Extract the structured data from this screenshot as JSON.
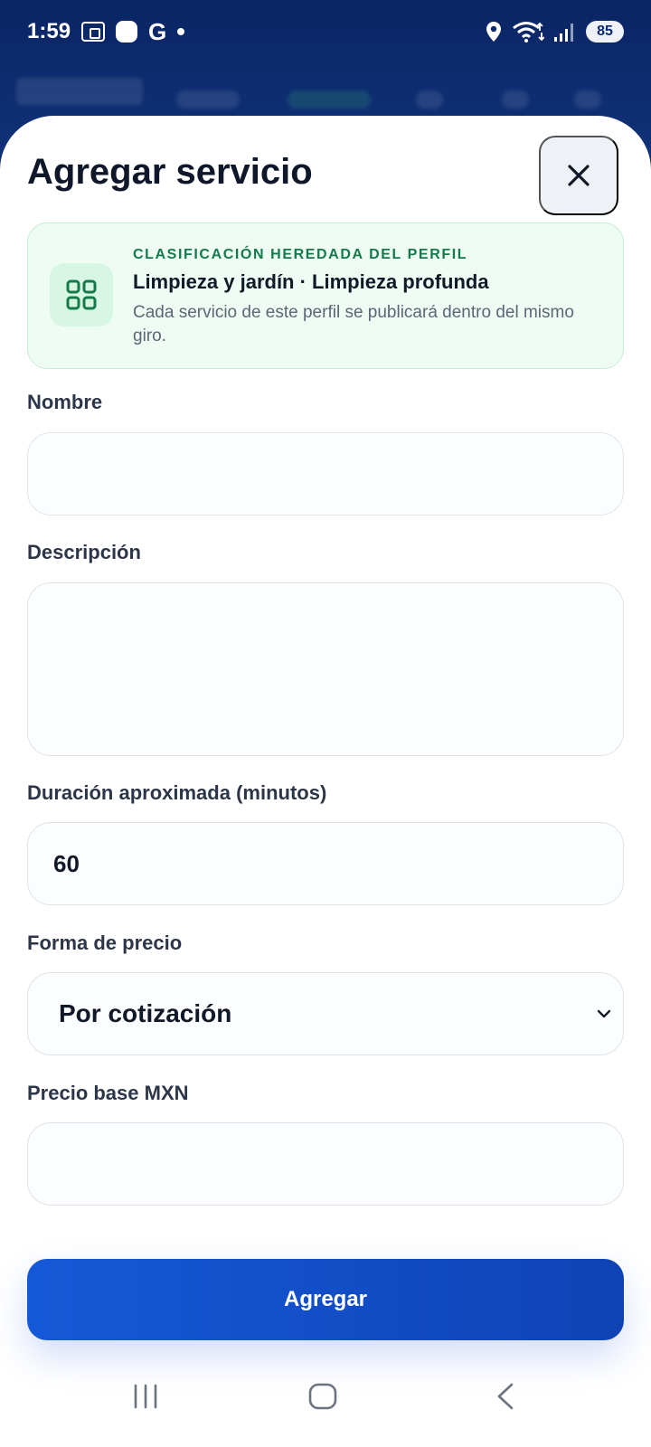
{
  "status_bar": {
    "time": "1:59",
    "notification_letter": "G",
    "battery": "85"
  },
  "sheet": {
    "title": "Agregar servicio",
    "close_label": "Cerrar"
  },
  "inherited_card": {
    "eyebrow": "CLASIFICACIÓN HEREDADA DEL PERFIL",
    "title": "Limpieza y jardín · Limpieza profunda",
    "text": "Cada servicio de este perfil se publicará dentro del mismo giro."
  },
  "form": {
    "name_label": "Nombre",
    "name_value": "",
    "description_label": "Descripción",
    "description_value": "",
    "duration_label": "Duración aproximada (minutos)",
    "duration_value": "60",
    "price_form_label": "Forma de precio",
    "price_form_value": "Por cotización",
    "base_price_label": "Precio base MXN",
    "base_price_value": ""
  },
  "actions": {
    "submit_label": "Agregar"
  },
  "colors": {
    "accent": "#1459d8",
    "success": "#157a4b",
    "success_bg": "#eefcf3"
  },
  "icons": {
    "close": "close-icon",
    "category": "grid-icon",
    "select": "chevron-down-icon"
  }
}
